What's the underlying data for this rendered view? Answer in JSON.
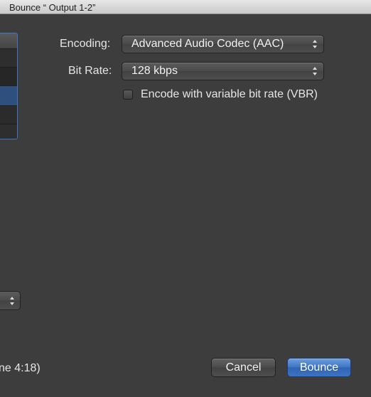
{
  "window": {
    "title": "Bounce “ Output 1-2”"
  },
  "encoding": {
    "label": "Encoding:",
    "value": "Advanced Audio Codec (AAC)"
  },
  "bit_rate": {
    "label": "Bit Rate:",
    "value": "128 kbps"
  },
  "vbr": {
    "label": "Encode with variable bit rate (VBR)",
    "checked": false
  },
  "info_text": "ne 4:18)",
  "buttons": {
    "cancel": "Cancel",
    "bounce": "Bounce"
  },
  "colors": {
    "accent": "#3f73c2",
    "selection": "#2f4f7d",
    "background": "#3d3d3d"
  }
}
